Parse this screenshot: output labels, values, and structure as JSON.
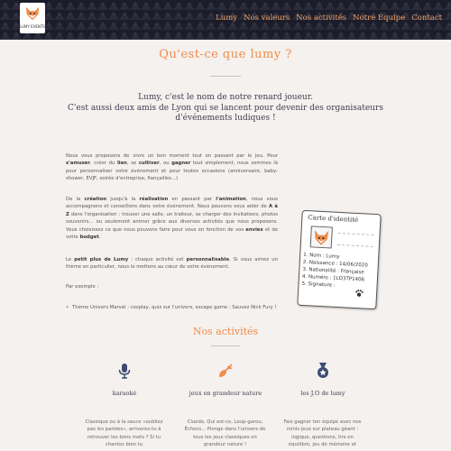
{
  "header": {
    "logo_text": "LUMY EVENTS",
    "nav": [
      "Lumy",
      "Nos valeurs",
      "Nos activités",
      "Notre Équipe",
      "Contact"
    ]
  },
  "colors": {
    "accent": "#ef8b4b",
    "nav": "#f0a266",
    "header_bg": "#1c1d2a",
    "body_bg": "#f4f1ee",
    "icon_blue": "#3d4b73"
  },
  "about": {
    "title": "Qu'est-ce que lumy ?",
    "intro_line1": "Lumy, c'est le nom de notre renard joueur.",
    "intro_line2": "C'est aussi deux amis de Lyon qui se lancent pour devenir des organisateurs d'événements ludiques !",
    "p1_a": "Nous vous proposons de vivre un bon moment tout en passant par le jeu. Pour ",
    "p1_b": "s'amuser",
    "p1_c": ", créer du ",
    "p1_d": "lien",
    "p1_e": ", se ",
    "p1_f": "cultiver",
    "p1_g": ", ou ",
    "p1_h": "gagner",
    "p1_i": " tout simplement, nous sommes là pour personnaliser votre événement et pour toutes occasions (anniversaire, baby-shower, EVJF, soirée d'entreprise, fiançailles...)",
    "p2_a": "De la ",
    "p2_b": "création",
    "p2_c": " jusqu'à la ",
    "p2_d": "réalisation",
    "p2_e": " en passant par ",
    "p2_f": "l'animation",
    "p2_g": ", nous vous accompagnons et conseillons dans votre événement. Nous pouvons vous aider de ",
    "p2_h": "A à Z",
    "p2_i": " dans l'organisation : trouver une salle, un traiteur, se charger des invitations, photos souvenirs... ou seulement animer grâce aux diverses activités que nous proposons. Vous choisissez ce que nous pouvons faire pour vous en fonction de vos ",
    "p2_j": "envies",
    "p2_k": " et de votre ",
    "p2_l": "budget",
    "p2_m": ".",
    "p3_a": "Le ",
    "p3_b": "petit plus de Lumy",
    "p3_c": " : chaque activité est ",
    "p3_d": "personnalisable",
    "p3_e": ". Si vous aimez un thème en particulier, nous le mettons au cœur de votre événement.",
    "p4": "Par exemple :",
    "li1": "Thème Univers Marvel : cosplay, quiz sur l'univers, escape game : Sauvez Nick Fury !"
  },
  "id_card": {
    "title": "Carte d'identité",
    "l1": "1. Nom : Lumy",
    "l2": "2. Naissance : 14/06/2020",
    "l3": "3. Nationalité : Française",
    "l4": "4. Numéro : 1LD3TP1406",
    "l5": "5. Signature :"
  },
  "activities": {
    "title": "Nos activités",
    "items": [
      {
        "name": "karaoké",
        "icon": "microphone-icon",
        "desc": "Classique ou à la sauce «oubliez pas les paroles», arriverez-tu à retrouver les bons mots ? Si tu chantes bien tu"
      },
      {
        "name": "jeux en grandeur nature",
        "icon": "shovel-leaf-icon",
        "desc": "Cluedo, Qui est-ce, Loup-garou, Échecs... Plonge dans l'univers de tous les jeux classiques en grandeur nature !"
      },
      {
        "name": "les J.O de lumy",
        "icon": "medal-icon",
        "desc": "Fais gagner ton équipe avec nos minis jeux sur plateau géant : logique, questions, tirs en équilibre, jeu de mémoire et"
      }
    ]
  }
}
